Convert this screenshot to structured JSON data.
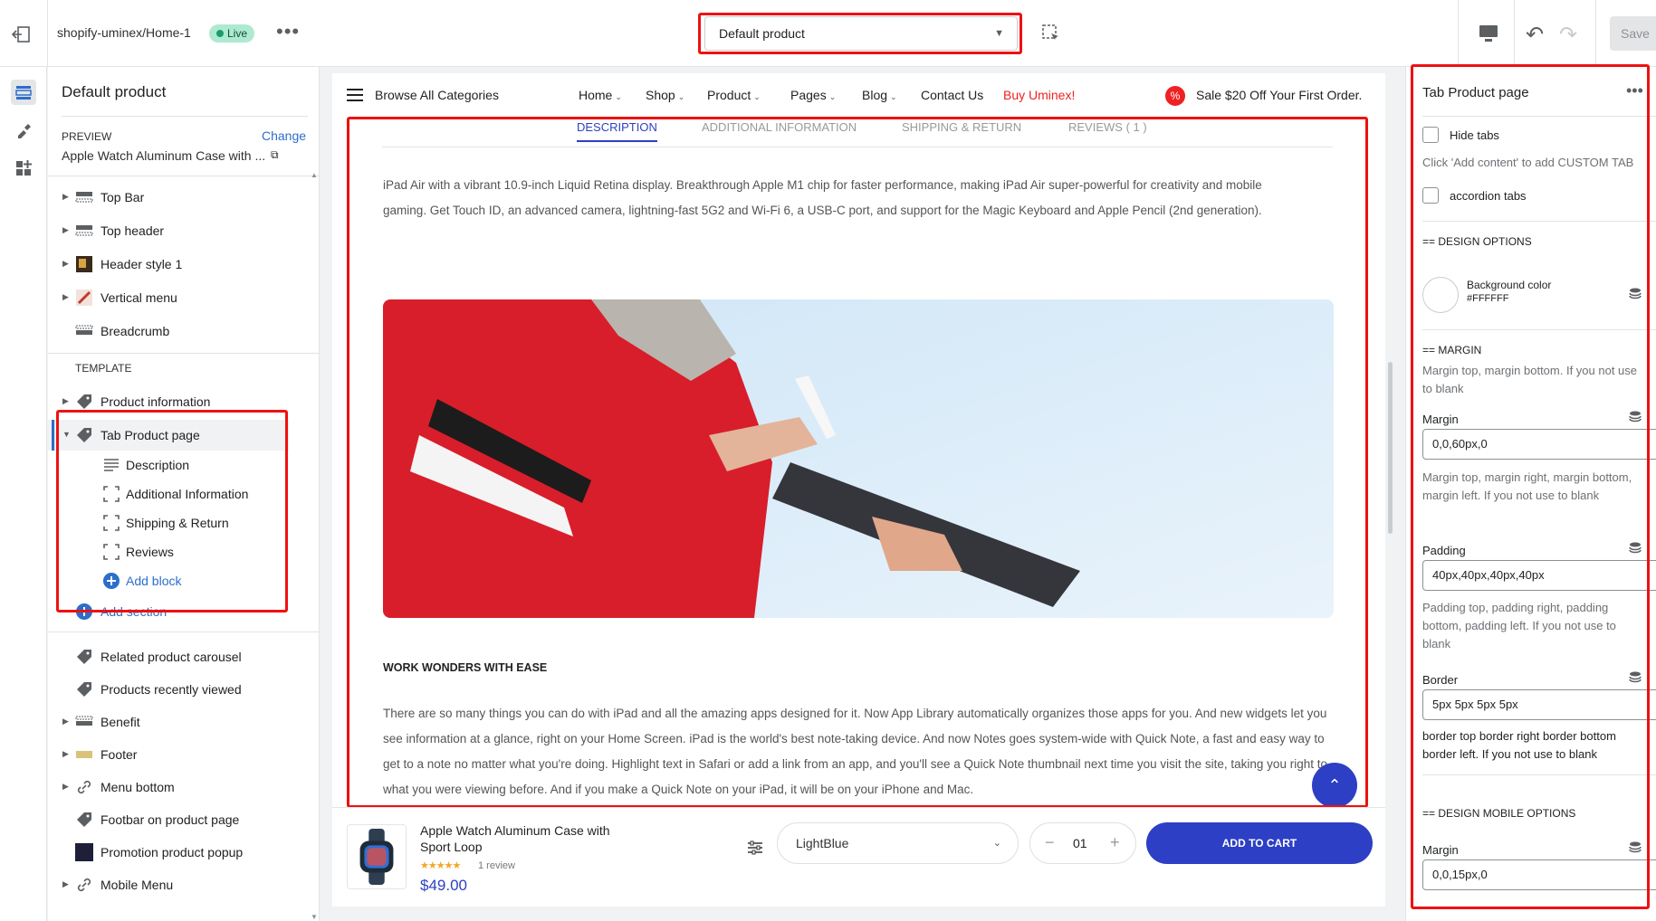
{
  "topbar": {
    "store_name": "shopify-uminex/Home-1",
    "live_badge": "Live",
    "template_select": "Default product",
    "save_label": "Save"
  },
  "left_panel": {
    "title": "Default product",
    "preview_label": "PREVIEW",
    "change_label": "Change",
    "preview_value": "Apple Watch Aluminum Case with ...",
    "header_items": [
      {
        "label": "Top Bar"
      },
      {
        "label": "Top header"
      },
      {
        "label": "Header style 1"
      },
      {
        "label": "Vertical menu"
      },
      {
        "label": "Breadcrumb"
      }
    ],
    "template_label": "TEMPLATE",
    "template_items": [
      {
        "label": "Product information"
      },
      {
        "label": "Tab Product page"
      }
    ],
    "tab_blocks": [
      {
        "label": "Description"
      },
      {
        "label": "Additional Information"
      },
      {
        "label": "Shipping & Return"
      },
      {
        "label": "Reviews"
      }
    ],
    "add_block": "Add block",
    "add_section": "Add section",
    "footer_items": [
      {
        "label": "Related product carousel"
      },
      {
        "label": "Products recently viewed"
      },
      {
        "label": "Benefit"
      },
      {
        "label": "Footer"
      },
      {
        "label": "Menu bottom"
      },
      {
        "label": "Footbar on product page"
      },
      {
        "label": "Promotion product popup"
      },
      {
        "label": "Mobile Menu"
      }
    ]
  },
  "storefront": {
    "nav": {
      "browse": "Browse All Categories",
      "items": [
        "Home",
        "Shop",
        "Product",
        "Pages",
        "Blog"
      ],
      "contact": "Contact Us",
      "buy": "Buy Uminex!",
      "sale": "Sale $20 Off Your First Order."
    },
    "tabs": [
      "DESCRIPTION",
      "ADDITIONAL INFORMATION",
      "SHIPPING & RETURN",
      "REVIEWS ( 1 )"
    ],
    "desc_p1": "iPad Air with a vibrant 10.9-inch Liquid Retina display. Breakthrough Apple M1 chip for faster performance, making iPad Air super-powerful for creativity and mobile gaming. Get Touch ID, an advanced camera, lightning-fast 5G2 and Wi-Fi 6, a USB-C port, and support for the Magic Keyboard and Apple Pencil (2nd generation).",
    "wonders_heading": "WORK WONDERS WITH EASE",
    "desc_p2": "There are so many things you can do with iPad and all the amazing apps designed for it. Now App Library automatically organizes those apps for you. And new widgets let you see information at a glance, right on your Home Screen. iPad is the world's best note-taking device. And now Notes goes system-wide with Quick Note, a fast and easy way to get to a note no matter what you're doing. Highlight text in Safari or add a link from an app, and you'll see a Quick Note thumbnail next time you visit the site, taking you right to what you were viewing before. And if you make a Quick Note on your iPad, it will be on your iPhone and Mac.",
    "sticky": {
      "title": "Apple Watch Aluminum Case with Sport Loop",
      "stars": "★★★★★",
      "rating": 5,
      "review": "1 review",
      "price": "$49.00",
      "variant": "LightBlue",
      "qty": "01",
      "add_to_cart": "ADD TO CART"
    }
  },
  "right_panel": {
    "title": "Tab Product page",
    "hide_tabs": "Hide tabs",
    "custom_hint": "Click 'Add content' to add CUSTOM TAB",
    "accordion": "accordion tabs",
    "design_options": "== DESIGN OPTIONS",
    "bg_color_label": "Background color",
    "bg_color_value": "#FFFFFF",
    "margin_head": "== MARGIN",
    "margin_hint": "Margin top, margin bottom. If you not use to blank",
    "margin_label": "Margin",
    "margin_value": "0,0,60px,0",
    "margin_hint2": "Margin top, margin right, margin bottom, margin left. If you not use to blank",
    "padding_label": "Padding",
    "padding_value": "40px,40px,40px,40px",
    "padding_hint": "Padding top, padding right, padding bottom, padding left. If you not use to blank",
    "border_label": "Border",
    "border_value": "5px 5px 5px 5px",
    "border_hint": "border top border right border bottom border left. If you not use to blank",
    "mobile_head": "== DESIGN MOBILE OPTIONS",
    "mobile_margin_label": "Margin",
    "mobile_margin_value": "0,0,15px,0"
  },
  "colors": {
    "accent": "#2d3fc4",
    "highlight": "#ee1111",
    "live_badge": "#aee9d1"
  }
}
